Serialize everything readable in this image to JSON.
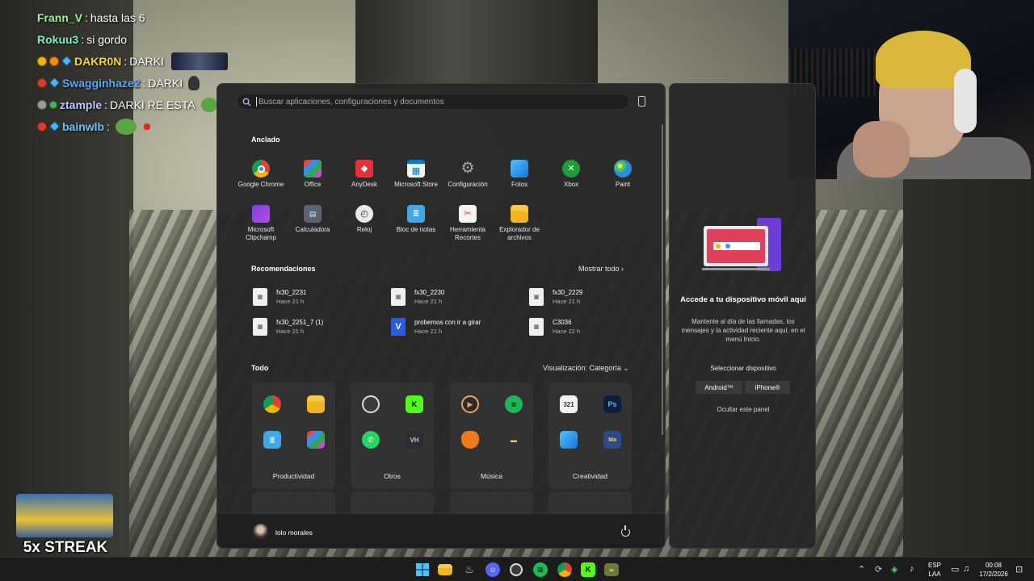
{
  "chat": [
    {
      "user": "Frann_V",
      "sep": ": ",
      "msg": "hasta las 6",
      "color": "#9ff29a"
    },
    {
      "user": "Rokuu3",
      "sep": ": ",
      "msg": "si gordo",
      "color": "#7ff0d2"
    },
    {
      "user": "DAKR0N",
      "sep": ": ",
      "msg": "DARKI",
      "color": "#f4d34a"
    },
    {
      "user": "Swagginhaze2",
      "sep": ": ",
      "msg": "DARKI",
      "color": "#5aa7ff"
    },
    {
      "user": "ztample",
      "sep": ": ",
      "msg": "DARKI RE ESTA",
      "color": "#bfc6ff"
    },
    {
      "user": "bainwlb",
      "sep": ": ",
      "msg": "",
      "color": "#6cc6ff"
    }
  ],
  "streak": {
    "label": "5x STREAK"
  },
  "start_menu": {
    "search_placeholder": "Buscar aplicaciones, configuraciones y documentos",
    "pinned_title": "Anclado",
    "pinned": [
      {
        "label": "Google Chrome",
        "icon": "chrome-icon"
      },
      {
        "label": "Office",
        "icon": "office-icon"
      },
      {
        "label": "AnyDesk",
        "icon": "anydesk-icon"
      },
      {
        "label": "Microsoft Store",
        "icon": "store-icon"
      },
      {
        "label": "Configuración",
        "icon": "settings-icon"
      },
      {
        "label": "Fotos",
        "icon": "photos-icon"
      },
      {
        "label": "Xbox",
        "icon": "xbox-icon"
      },
      {
        "label": "Paint",
        "icon": "paint-icon"
      },
      {
        "label": "Microsoft Clipchamp",
        "icon": "clipchamp-icon"
      },
      {
        "label": "Calculadora",
        "icon": "calculator-icon"
      },
      {
        "label": "Reloj",
        "icon": "clock-icon"
      },
      {
        "label": "Bloc de notas",
        "icon": "notepad-icon"
      },
      {
        "label": "Herramienta Recortes",
        "icon": "snipping-tool-icon"
      },
      {
        "label": "Explorador de archivos",
        "icon": "file-explorer-icon"
      }
    ],
    "recommended_title": "Recomendaciones",
    "show_all": "Mostrar todo",
    "recommended": [
      {
        "name": "fx30_2231",
        "time": "Hace 21 h"
      },
      {
        "name": "fx30_2230",
        "time": "Hace 21 h"
      },
      {
        "name": "fx30_2229",
        "time": "Hace 21 h"
      },
      {
        "name": "fx30_2251_7 (1)",
        "time": "Hace 21 h"
      },
      {
        "name": "probemos con ir a girar",
        "time": "Hace 21 h"
      },
      {
        "name": "C3036",
        "time": "Hace 22 h"
      }
    ],
    "all_title": "Todo",
    "view_label": "Visualización: Categoría",
    "categories": [
      {
        "label": "Productividad"
      },
      {
        "label": "Otros"
      },
      {
        "label": "Música"
      },
      {
        "label": "Creatividad"
      }
    ],
    "user_name": "lolo morales"
  },
  "side_panel": {
    "title": "Accede a tu dispositivo móvil aquí",
    "body": "Mantente al día de las llamadas, los mensajes y la actividad reciente aquí, en el menú Inicio.",
    "select": "Seleccionar dispositivo",
    "android": "Android™",
    "iphone": "iPhone®",
    "hide": "Ocultar este panel"
  },
  "taskbar": {
    "lang1": "ESP",
    "lang2": "LAA",
    "time": "00:08",
    "date": "17/2/2026"
  }
}
